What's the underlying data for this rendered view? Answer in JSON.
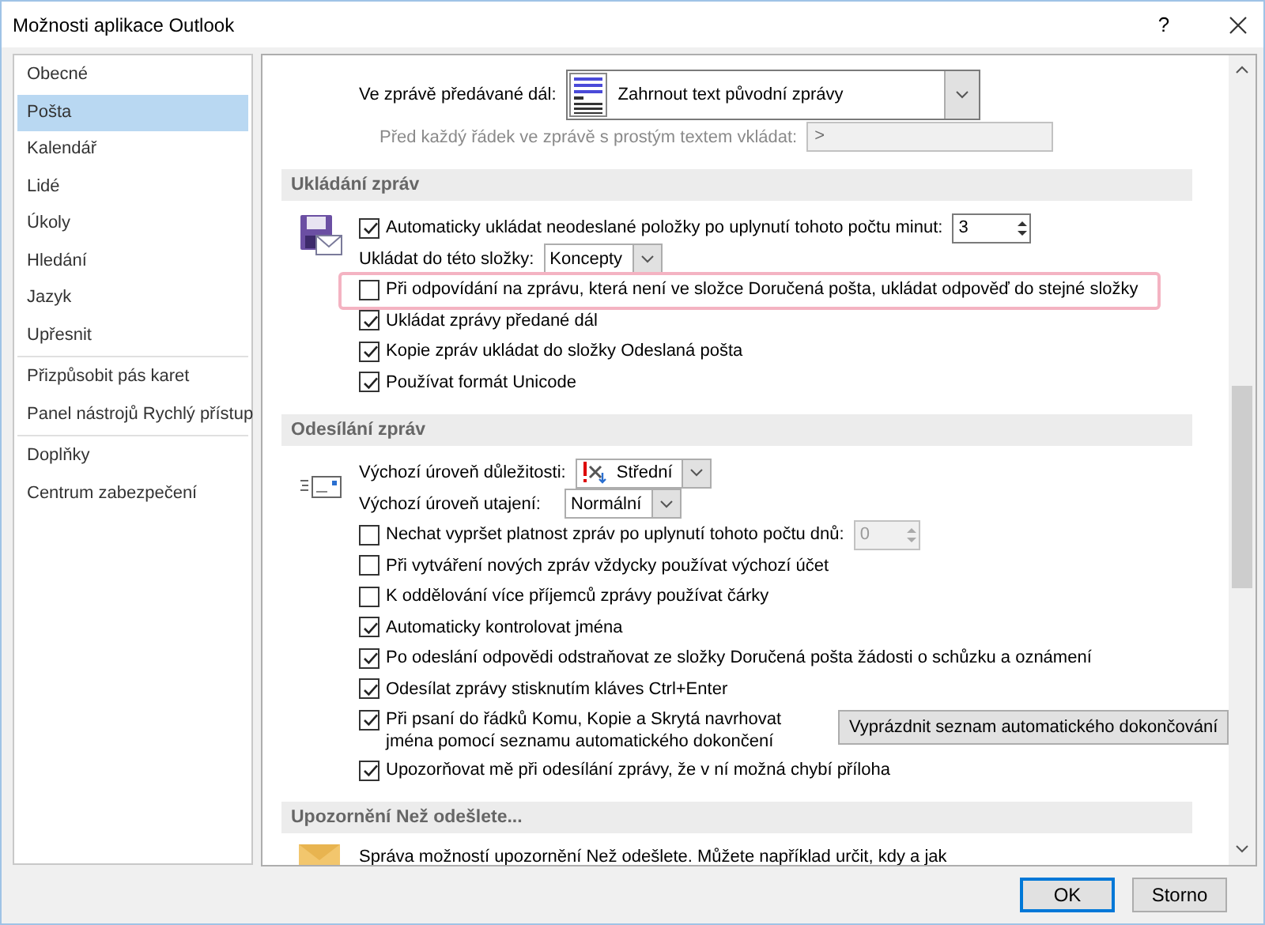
{
  "window": {
    "title": "Možnosti aplikace Outlook",
    "help": "?"
  },
  "sidebar": {
    "groups": [
      [
        {
          "label": "Obecné",
          "selected": false
        },
        {
          "label": "Pošta",
          "selected": true
        },
        {
          "label": "Kalendář",
          "selected": false
        },
        {
          "label": "Lidé",
          "selected": false
        },
        {
          "label": "Úkoly",
          "selected": false
        },
        {
          "label": "Hledání",
          "selected": false
        },
        {
          "label": "Jazyk",
          "selected": false
        },
        {
          "label": "Upřesnit",
          "selected": false
        }
      ],
      [
        {
          "label": "Přizpůsobit pás karet",
          "selected": false
        },
        {
          "label": "Panel nástrojů Rychlý přístup",
          "selected": false
        }
      ],
      [
        {
          "label": "Doplňky",
          "selected": false
        },
        {
          "label": "Centrum zabezpečení",
          "selected": false
        }
      ]
    ]
  },
  "content": {
    "top_rows": [
      {
        "kind": "format-select",
        "label": "Ve zprávě předávané dál:",
        "value": "Zahrnout text původní zprávy"
      },
      {
        "kind": "text",
        "label": "Před každý řádek ve zprávě s prostým textem vkládat:",
        "value": ">",
        "disabled": true
      }
    ],
    "sections": [
      {
        "title": "Ukládání zpráv",
        "rows": [
          {
            "kind": "checkbox",
            "label": "Automaticky ukládat neodeslané položky po uplynutí tohoto počtu minut:",
            "checked": true,
            "spin": {
              "value": "3",
              "disabled": false
            }
          },
          {
            "kind": "select",
            "label": "Ukládat do této složky:",
            "value": "Koncepty"
          },
          {
            "kind": "checkbox",
            "label": "Při odpovídání na zprávu, která není ve složce Doručená pošta, ukládat odpověď do stejné složky",
            "checked": false,
            "highlighted": true
          },
          {
            "kind": "checkbox",
            "label": "Ukládat zprávy předané dál",
            "checked": true
          },
          {
            "kind": "checkbox",
            "label": "Kopie zpráv ukládat do složky Odeslaná pošta",
            "checked": true
          },
          {
            "kind": "checkbox",
            "label": "Používat formát Unicode",
            "checked": true
          }
        ]
      },
      {
        "title": "Odesílání zpráv",
        "rows": [
          {
            "kind": "priority-select",
            "label": "Výchozí úroveň důležitosti:",
            "value": "Střední"
          },
          {
            "kind": "select",
            "label": "Výchozí úroveň utajení:",
            "value": "Normální"
          },
          {
            "kind": "checkbox",
            "label": "Nechat vypršet platnost zpráv po uplynutí tohoto počtu dnů:",
            "checked": false,
            "spin": {
              "value": "0",
              "disabled": true
            }
          },
          {
            "kind": "checkbox",
            "label": "Při vytváření nových zpráv vždycky používat výchozí účet",
            "checked": false
          },
          {
            "kind": "checkbox",
            "label": "K oddělování více příjemců zprávy používat čárky",
            "checked": false
          },
          {
            "kind": "checkbox",
            "label": "Automaticky kontrolovat jména",
            "checked": true
          },
          {
            "kind": "checkbox",
            "label": "Po odeslání odpovědi odstraňovat ze složky Doručená pošta žádosti o schůzku a oznámení",
            "checked": true
          },
          {
            "kind": "checkbox",
            "label": "Odesílat zprávy stisknutím kláves Ctrl+Enter",
            "checked": true
          },
          {
            "kind": "checkbox",
            "label": "Při psaní do řádků Komu, Kopie a Skrytá navrhovat jména pomocí seznamu automatického dokončení",
            "checked": true,
            "button": "Vyprázdnit seznam automatického dokončování"
          },
          {
            "kind": "checkbox",
            "label": "Upozorňovat mě při odesílání zprávy, že v ní možná chybí příloha",
            "checked": true
          }
        ]
      },
      {
        "title": "Upozornění Než odešlete...",
        "rows": [
          {
            "kind": "note",
            "text": "Správa možností upozornění Než odešlete. Můžete například určit, kdy a jak"
          }
        ]
      }
    ]
  },
  "buttons": [
    {
      "label": "OK",
      "default": true
    },
    {
      "label": "Storno",
      "default": false
    }
  ]
}
